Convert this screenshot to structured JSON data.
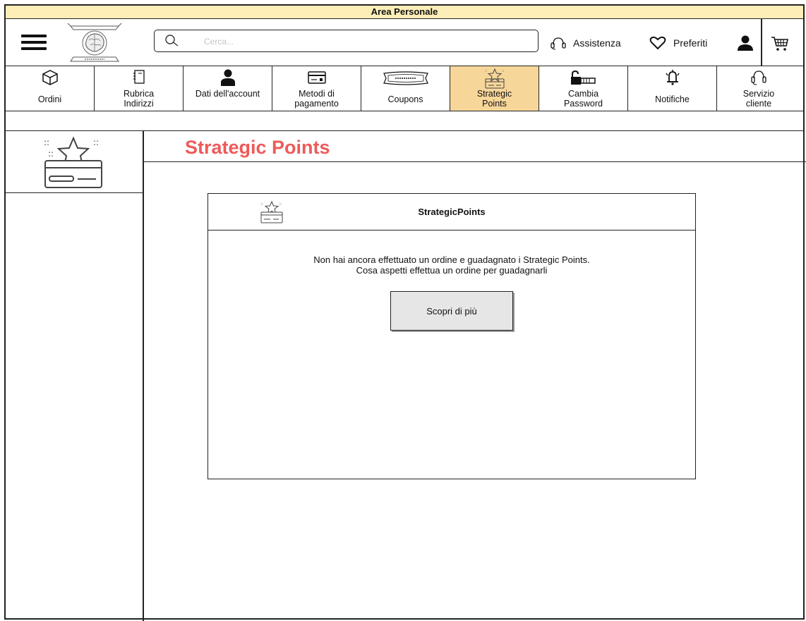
{
  "window": {
    "title": "Area Personale"
  },
  "header": {
    "search_placeholder": "Cerca...",
    "assistance_label": "Assistenza",
    "favorites_label": "Preferiti"
  },
  "tabs": [
    {
      "id": "orders",
      "label": "Ordini",
      "icon": "package-icon",
      "active": false
    },
    {
      "id": "address-book",
      "label": "Rubrica Indirizzi",
      "icon": "address-book-icon",
      "active": false
    },
    {
      "id": "account-data",
      "label": "Dati dell'account",
      "icon": "user-icon",
      "active": false
    },
    {
      "id": "payment-methods",
      "label": "Metodi di pagamento",
      "icon": "credit-card-icon",
      "active": false
    },
    {
      "id": "coupons",
      "label": "Coupons",
      "icon": "coupon-icon",
      "active": false
    },
    {
      "id": "strategic-points",
      "label": "Strategic Points",
      "icon": "star-card-icon",
      "active": true
    },
    {
      "id": "change-password",
      "label": "Cambia Password",
      "icon": "lock-key-icon",
      "active": false
    },
    {
      "id": "notifications",
      "label": "Notifiche",
      "icon": "bell-icon",
      "active": false
    },
    {
      "id": "customer-service",
      "label": "Servizio cliente",
      "icon": "headset-icon",
      "active": false
    }
  ],
  "main": {
    "page_title": "Strategic Points",
    "card": {
      "title": "StrategicPoints",
      "message_line1": "Non hai ancora effettuato un ordine e guadagnato i Strategic Points.",
      "message_line2": "Cosa aspetti effettua un ordine per guadagnarli",
      "button_label": "Scopri di più"
    }
  },
  "colors": {
    "titlebar_bg": "#fdeeb8",
    "active_tab_bg": "#f7d69a",
    "page_title": "#ee5a5a",
    "button_bg": "#e6e6e6"
  }
}
